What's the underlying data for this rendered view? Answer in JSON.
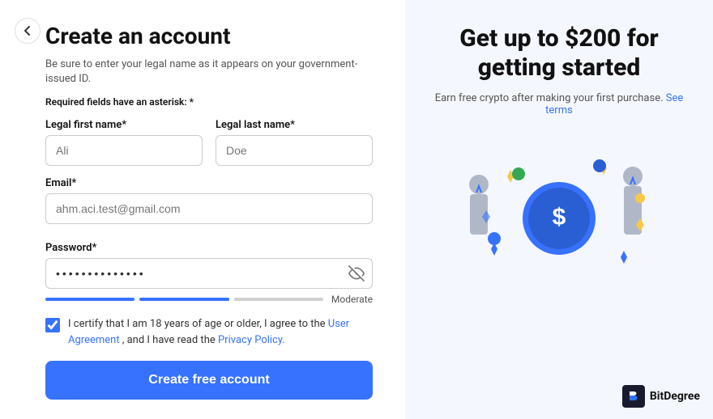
{
  "page": {
    "title": "Create an account",
    "subtitle": "Be sure to enter your legal name as it appears on your government-issued ID.",
    "required_note": "Required fields have an asterisk: *"
  },
  "form": {
    "first_name_label": "Legal first name*",
    "first_name_placeholder": "Ali",
    "last_name_label": "Legal last name*",
    "last_name_placeholder": "Doe",
    "email_label": "Email*",
    "email_placeholder": "ahm.aci.test@gmail.com",
    "password_label": "Password*",
    "password_value": "•••••••••••••",
    "strength_label": "Moderate",
    "checkbox_text": "I certify that I am 18 years of age or older, I agree to the",
    "user_agreement_link": "User Agreement",
    "checkbox_text2": ", and I have read the",
    "privacy_policy_link": "Privacy Policy.",
    "submit_label": "Create free account"
  },
  "promo": {
    "title": "Get up to $200 for getting started",
    "subtitle": "Earn free crypto after making your first purchase.",
    "see_terms": "See terms"
  },
  "brand": {
    "name": "BitDegree",
    "logo_letter": "B"
  },
  "strength_segments": [
    {
      "color": "#3772ff",
      "filled": true
    },
    {
      "color": "#3772ff",
      "filled": true
    },
    {
      "color": "#d0d0d0",
      "filled": false
    }
  ],
  "colors": {
    "accent": "#3772ff",
    "strength_filled": "#3772ff",
    "strength_empty": "#d0d0d0"
  }
}
